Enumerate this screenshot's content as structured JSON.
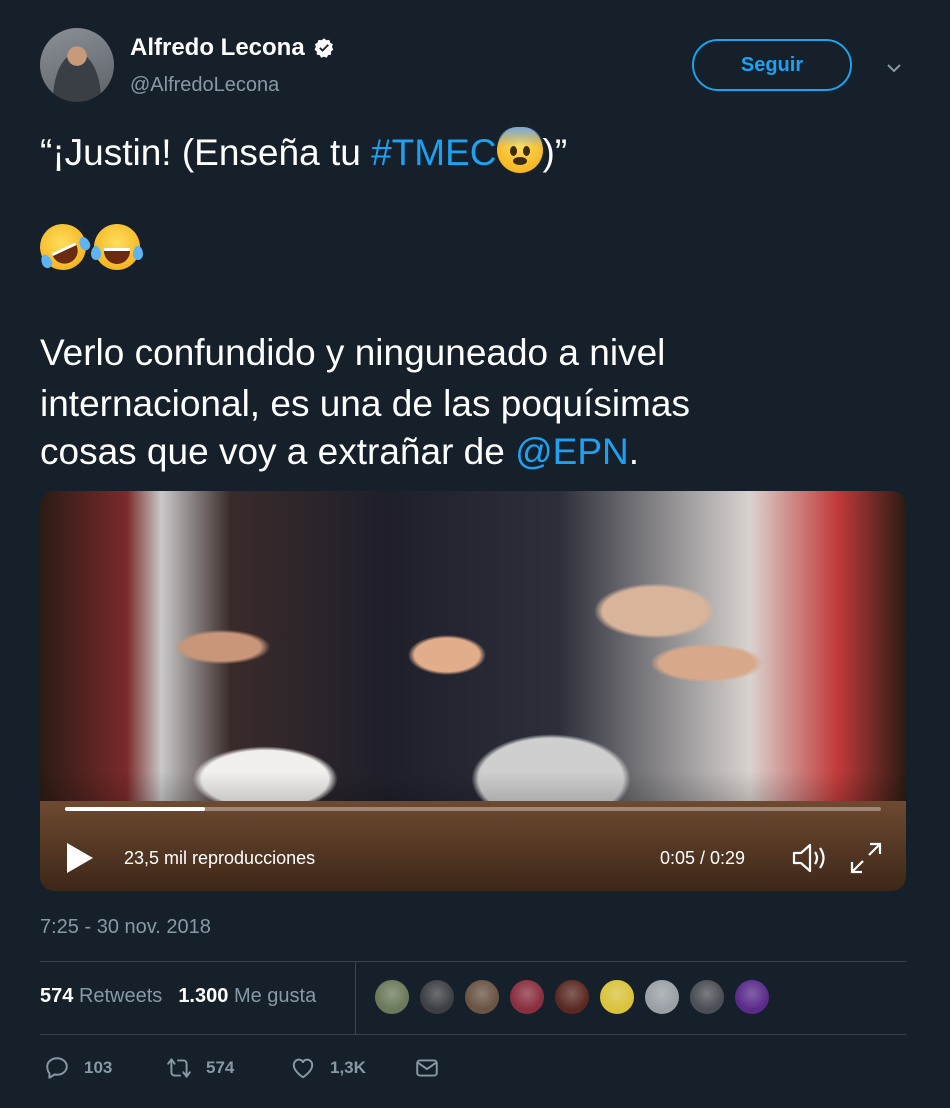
{
  "author": {
    "name": "Alfredo Lecona",
    "handle": "@AlfredoLecona",
    "follow_label": "Seguir"
  },
  "tweet": {
    "line1_prefix": "“¡Justin! (Enseña tu ",
    "hashtag": "#TMEC",
    "line1_suffix": ")”",
    "body_line1": "Verlo confundido y ninguneado a nivel",
    "body_line2": "internacional, es una de las poquísimas",
    "body_line3_prefix": "cosas que voy a extrañar de ",
    "mention": "@EPN",
    "body_line3_suffix": "."
  },
  "video": {
    "views": "23,5 mil reproducciones",
    "time": "0:05 / 0:29",
    "progress_fraction": 0.172
  },
  "timestamp": "7:25 - 30 nov. 2018",
  "stats": {
    "retweets_count": "574",
    "retweets_label": "Retweets",
    "likes_count": "1.300",
    "likes_label": "Me gusta"
  },
  "likers_colors": [
    "#6b7a5a",
    "#3d3f44",
    "#6a5444",
    "#8a2f3f",
    "#5a2a22",
    "#d9c33b",
    "#9aa0a6",
    "#4b4f55",
    "#5a2b8a"
  ],
  "actions": {
    "replies": "103",
    "retweets": "574",
    "likes": "1,3K"
  },
  "colors": {
    "background": "#15202b",
    "accent": "#1da1f2",
    "muted": "#8899a6"
  }
}
